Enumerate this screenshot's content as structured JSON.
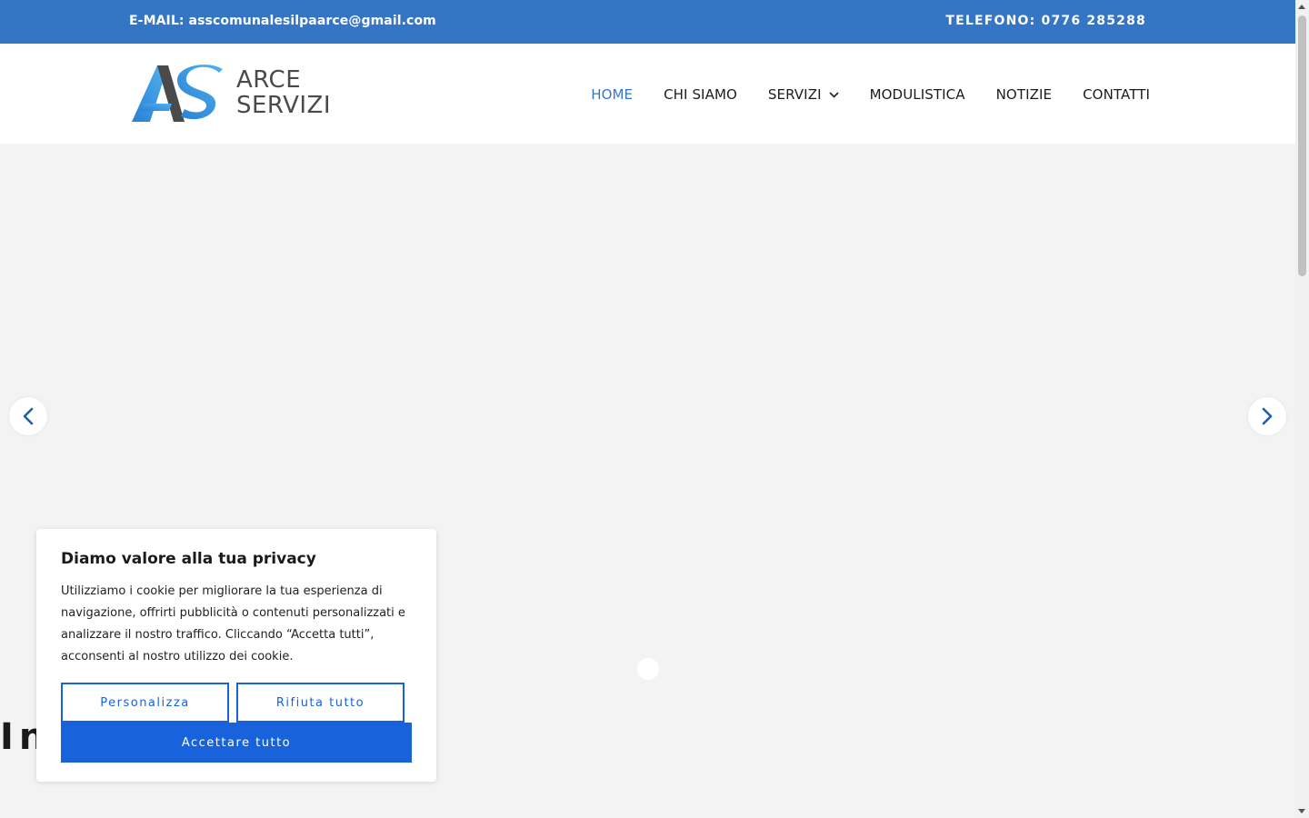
{
  "topbar": {
    "email": "E-MAIL: asscomunalesilpaarce@gmail.com",
    "phone": "TELEFONO: 0776 285288",
    "background": "#3475c5"
  },
  "logo": {
    "line1": "ARCE",
    "line2": "SERVIZI",
    "icon": "as-monogram-icon"
  },
  "nav": {
    "items": [
      {
        "label": "HOME",
        "active": true
      },
      {
        "label": "CHI SIAMO"
      },
      {
        "label": "SERVIZI",
        "icon": "chevron-down-icon"
      },
      {
        "label": "MODULISTICA"
      },
      {
        "label": "NOTIZIE"
      },
      {
        "label": "CONTATTI"
      }
    ],
    "active_color": "#3475c5"
  },
  "hero": {
    "heading": "In",
    "prev_icon": "chevron-left-icon",
    "next_icon": "chevron-right-icon"
  },
  "cookie": {
    "title": "Diamo valore alla tua privacy",
    "text": "Utilizziamo i cookie per migliorare la tua esperienza di navigazione, offrirti pubblicità o contenuti personalizzati e analizzare il nostro traffico. Cliccando “Accetta tutti”, acconsenti al nostro utilizzo dei cookie.",
    "customize_label": "Personalizza",
    "reject_label": "Rifiuta tutto",
    "accept_label": "Accettare tutto",
    "accent": "#1863dc"
  }
}
